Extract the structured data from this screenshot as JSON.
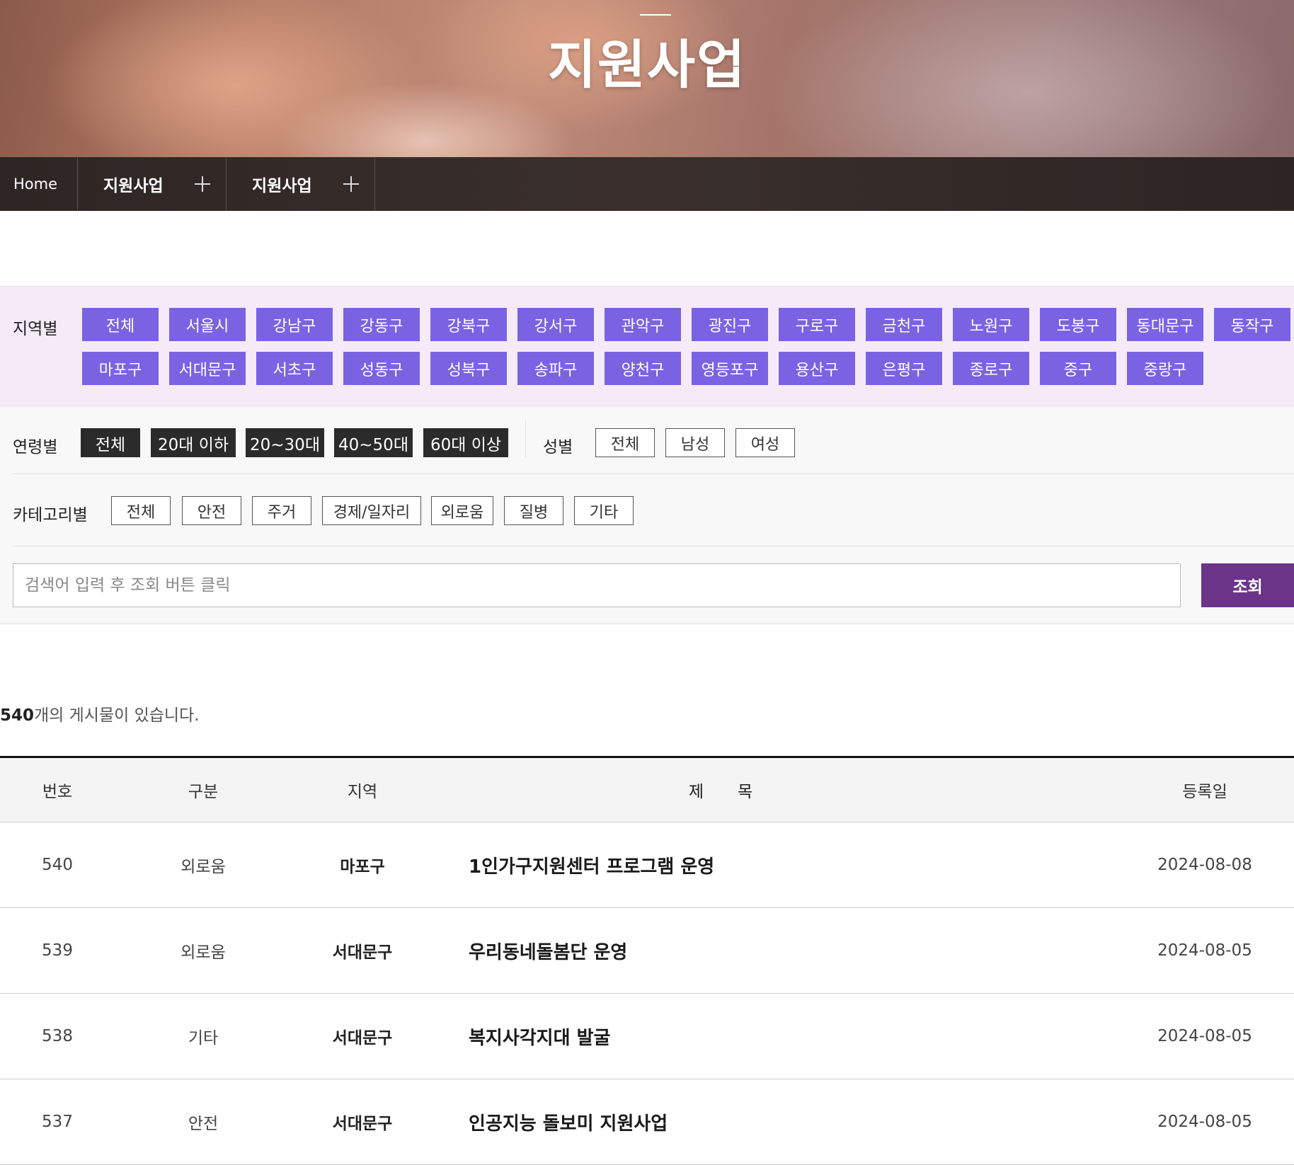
{
  "hero": {
    "title": "지원사업"
  },
  "nav": {
    "home": "Home",
    "crumb1": "지원사업",
    "crumb2": "지원사업"
  },
  "region": {
    "label": "지역별",
    "items": [
      "전체",
      "서울시",
      "강남구",
      "강동구",
      "강북구",
      "강서구",
      "관악구",
      "광진구",
      "구로구",
      "금천구",
      "노원구",
      "도봉구",
      "동대문구",
      "동작구",
      "마포구",
      "서대문구",
      "서초구",
      "성동구",
      "성북구",
      "송파구",
      "양천구",
      "영등포구",
      "용산구",
      "은평구",
      "종로구",
      "중구",
      "중랑구"
    ]
  },
  "age": {
    "label": "연령별",
    "items": [
      "전체",
      "20대 이하",
      "20~30대",
      "40~50대",
      "60대 이상"
    ]
  },
  "gender": {
    "label": "성별",
    "items": [
      "전체",
      "남성",
      "여성"
    ]
  },
  "category": {
    "label": "카테고리별",
    "items": [
      "전체",
      "안전",
      "주거",
      "경제/일자리",
      "외로움",
      "질병",
      "기타"
    ]
  },
  "search": {
    "placeholder": "검색어 입력 후 조회 버튼 클릭",
    "button": "조회"
  },
  "count": {
    "number": "540",
    "suffix": "개의 게시물이 있습니다."
  },
  "table": {
    "headers": {
      "num": "번호",
      "cat": "구분",
      "region": "지역",
      "title": "제목",
      "date": "등록일"
    },
    "rows": [
      {
        "num": "540",
        "cat": "외로움",
        "region": "마포구",
        "title": "1인가구지원센터 프로그램 운영",
        "date": "2024-08-08"
      },
      {
        "num": "539",
        "cat": "외로움",
        "region": "서대문구",
        "title": "우리동네돌봄단 운영",
        "date": "2024-08-05"
      },
      {
        "num": "538",
        "cat": "기타",
        "region": "서대문구",
        "title": "복지사각지대 발굴",
        "date": "2024-08-05"
      },
      {
        "num": "537",
        "cat": "안전",
        "region": "서대문구",
        "title": "인공지능 돌보미 지원사업",
        "date": "2024-08-05"
      }
    ]
  },
  "colors": {
    "region_button": "#7a63e3",
    "search_button": "#6b3489",
    "age_button": "#2b2b2b",
    "region_bg": "#f5ebf8"
  }
}
